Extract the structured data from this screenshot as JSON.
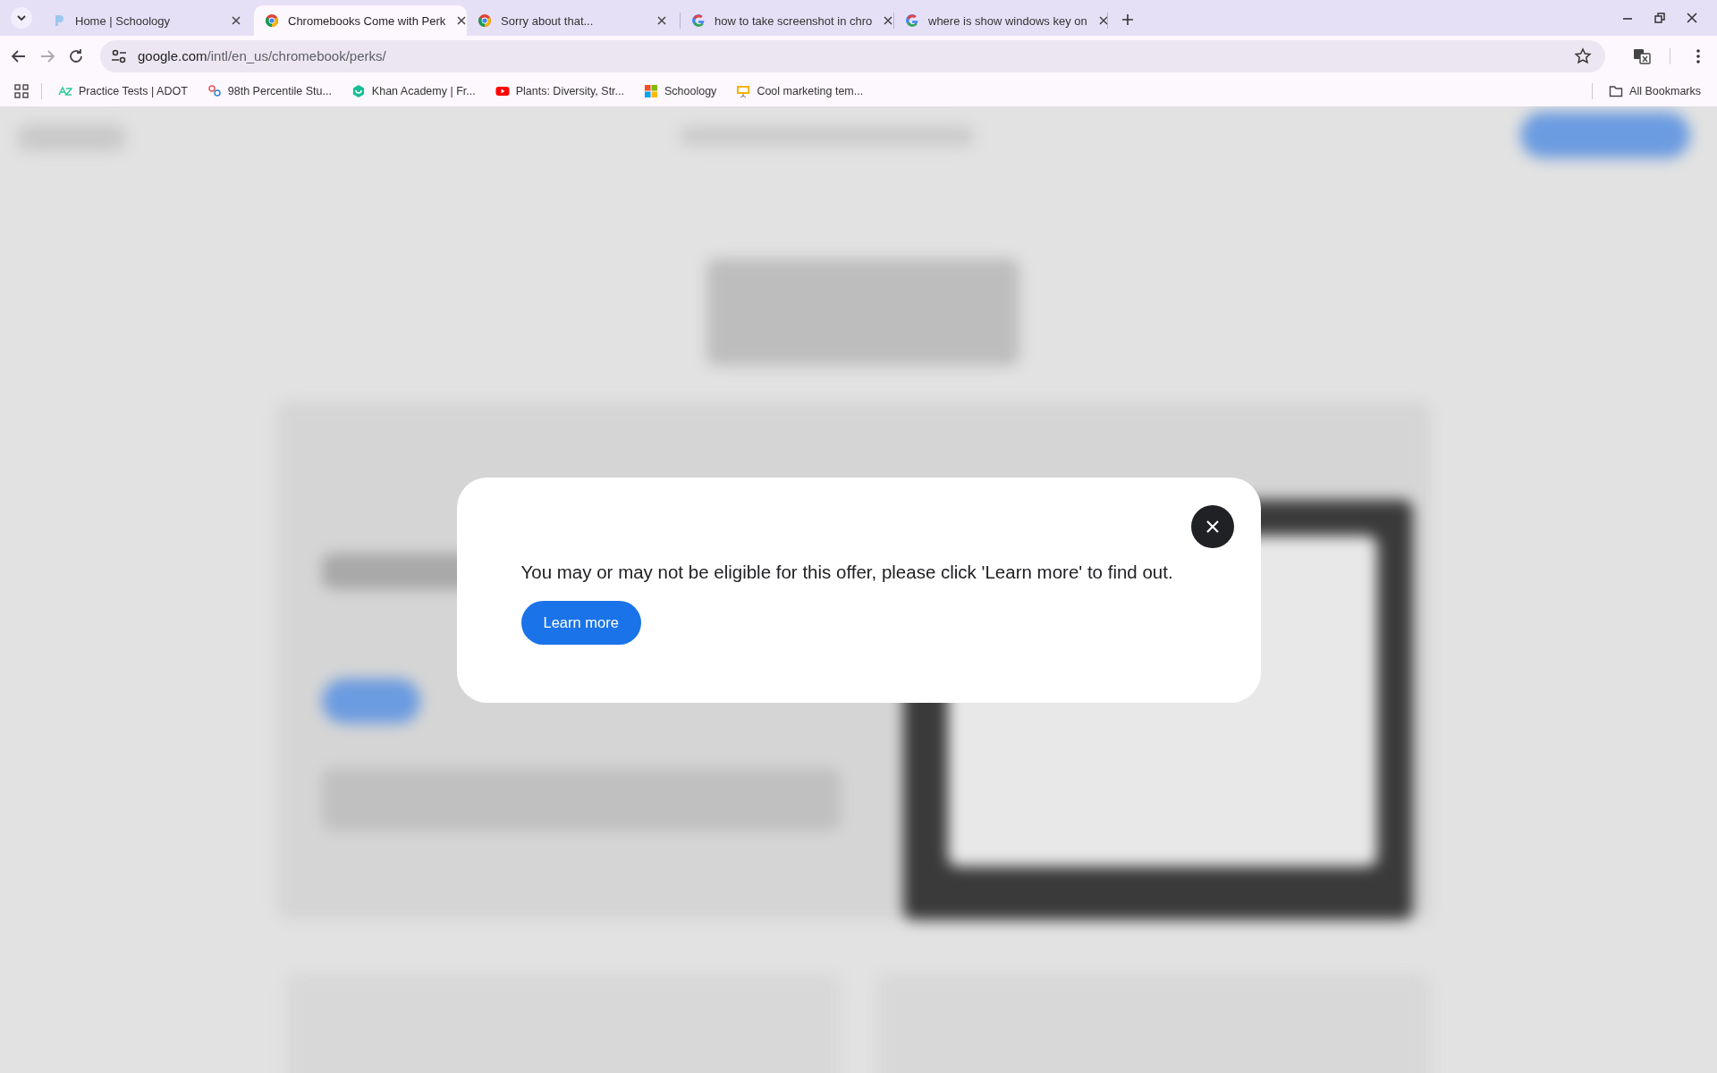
{
  "tabs": [
    {
      "title": "Home | Schoology",
      "kind": "schoology",
      "selected": false
    },
    {
      "title": "Chromebooks Come with Perk",
      "kind": "chrome",
      "selected": true
    },
    {
      "title": "Sorry about that...",
      "kind": "chrome",
      "selected": false
    },
    {
      "title": "how to take screenshot in chro",
      "kind": "google",
      "selected": false
    },
    {
      "title": "where is show windows key on",
      "kind": "google",
      "selected": false
    }
  ],
  "address_bar": {
    "host": "google.com",
    "path": "/intl/en_us/chromebook/perks/"
  },
  "bookmarks": [
    {
      "label": "Practice Tests | ADOT",
      "kind": "az"
    },
    {
      "label": "98th Percentile Stu...",
      "kind": "percentile"
    },
    {
      "label": "Khan Academy | Fr...",
      "kind": "khan"
    },
    {
      "label": "Plants: Diversity, Str...",
      "kind": "youtube"
    },
    {
      "label": "Schoology",
      "kind": "windows"
    },
    {
      "label": "Cool marketing tem...",
      "kind": "slides"
    }
  ],
  "all_bookmarks": "All Bookmarks",
  "dialog": {
    "message": "You may or may not be eligible for this offer, please click 'Learn more' to find out.",
    "button": "Learn more"
  }
}
